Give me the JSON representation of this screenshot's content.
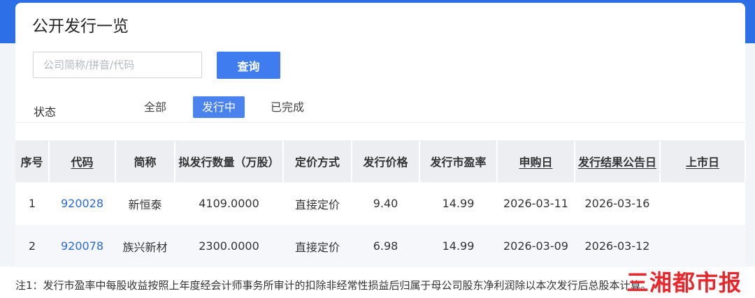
{
  "page": {
    "title": "公开发行一览"
  },
  "search": {
    "placeholder": "公司简称/拼音/代码",
    "button_label": "查询"
  },
  "status_filter": {
    "label": "状态",
    "options": [
      {
        "label": "全部",
        "active": false
      },
      {
        "label": "发行中",
        "active": true
      },
      {
        "label": "已完成",
        "active": false
      }
    ]
  },
  "table": {
    "headers": [
      "序号",
      "代码",
      "简称",
      "拟发行数量（万股）",
      "定价方式",
      "发行价格",
      "发行市盈率",
      "申购日",
      "发行结果公告日",
      "上市日"
    ],
    "rows": [
      [
        "1",
        "920028",
        "新恒泰",
        "4109.0000",
        "直接定价",
        "9.40",
        "14.99",
        "2026-03-11",
        "2026-03-16",
        ""
      ],
      [
        "2",
        "920078",
        "族兴新材",
        "2300.0000",
        "直接定价",
        "6.98",
        "14.99",
        "2026-03-09",
        "2026-03-12",
        ""
      ]
    ]
  },
  "note": "注1：发行市盈率中每股收益按照上年度经会计师事务所审计的扣除非经常性损益后归属于母公司股东净利润除以本次发行后总股本计算。",
  "watermark": "三湘都市报",
  "colors": {
    "header_bar": "#2d6fe6",
    "accent": "#3e7cf0",
    "link": "#2a6ad1",
    "watermark": "#e8262c"
  }
}
